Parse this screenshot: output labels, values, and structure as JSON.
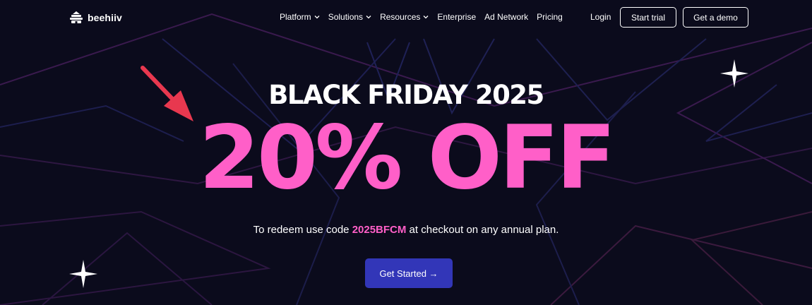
{
  "brand": {
    "name": "beehiiv",
    "icon": "beehive-icon"
  },
  "nav": {
    "items": [
      {
        "label": "Platform",
        "has_dropdown": true
      },
      {
        "label": "Solutions",
        "has_dropdown": true
      },
      {
        "label": "Resources",
        "has_dropdown": true
      },
      {
        "label": "Enterprise",
        "has_dropdown": false
      },
      {
        "label": "Ad Network",
        "has_dropdown": false
      },
      {
        "label": "Pricing",
        "has_dropdown": false
      }
    ],
    "login_label": "Login",
    "start_trial_label": "Start trial",
    "get_demo_label": "Get a demo"
  },
  "hero": {
    "headline": "BLACK FRIDAY 2025",
    "offer": "20% OFF",
    "redeem_prefix": "To redeem use code ",
    "code": "2025BFCM",
    "redeem_suffix": " at checkout on any annual plan.",
    "cta_label": "Get Started →"
  },
  "colors": {
    "background": "#0b0b1c",
    "accent_pink": "#ff5fc8",
    "cta_blue": "#3236b8",
    "annotation_arrow": "#e8384f"
  }
}
